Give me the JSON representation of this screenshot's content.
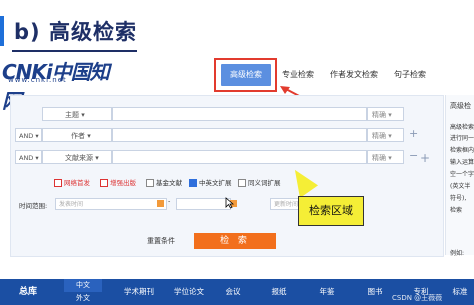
{
  "slide": {
    "title": "b) 高级检索"
  },
  "logo": {
    "brand": "CNKi中国知网",
    "url": "www.cnki.net"
  },
  "tabs": [
    {
      "label": "高级检索",
      "active": true
    },
    {
      "label": "专业检索",
      "active": false
    },
    {
      "label": "作者发文检索",
      "active": false
    },
    {
      "label": "句子检索",
      "active": false
    }
  ],
  "rows": [
    {
      "logic": "",
      "field": "主题",
      "match": "精确"
    },
    {
      "logic": "AND",
      "field": "作者",
      "match": "精确"
    },
    {
      "logic": "AND",
      "field": "文献来源",
      "match": "精确"
    }
  ],
  "checkboxes": [
    {
      "label": "网络首发",
      "checked": false,
      "red": true
    },
    {
      "label": "增强出版",
      "checked": false,
      "red": true
    },
    {
      "label": "基金文献",
      "checked": false,
      "red": false
    },
    {
      "label": "中英文扩展",
      "checked": true,
      "red": false
    },
    {
      "label": "同义词扩展",
      "checked": false,
      "red": false
    }
  ],
  "time": {
    "label": "时间范围:",
    "start_placeholder": "发表时间",
    "separator": "-",
    "update_label": "更新时间",
    "update_value": "不限"
  },
  "actions": {
    "reset": "重置条件",
    "search": "检 索"
  },
  "callout": {
    "text": "检索区域"
  },
  "side": {
    "title": "高级检",
    "lines": [
      "高级检索",
      "进行同一",
      "检索框内",
      "输入运算",
      "空一个字",
      "(英文半",
      "符号),",
      "检索"
    ],
    "example_label": "例如:"
  },
  "nav": {
    "total": "总库",
    "lang_active": "中文",
    "lang_other": "外文",
    "items": [
      "学术期刊",
      "学位论文",
      "会议",
      "报纸",
      "年鉴",
      "图书",
      "专利",
      "标准"
    ]
  },
  "watermark": "CSDN @王薇薇"
}
